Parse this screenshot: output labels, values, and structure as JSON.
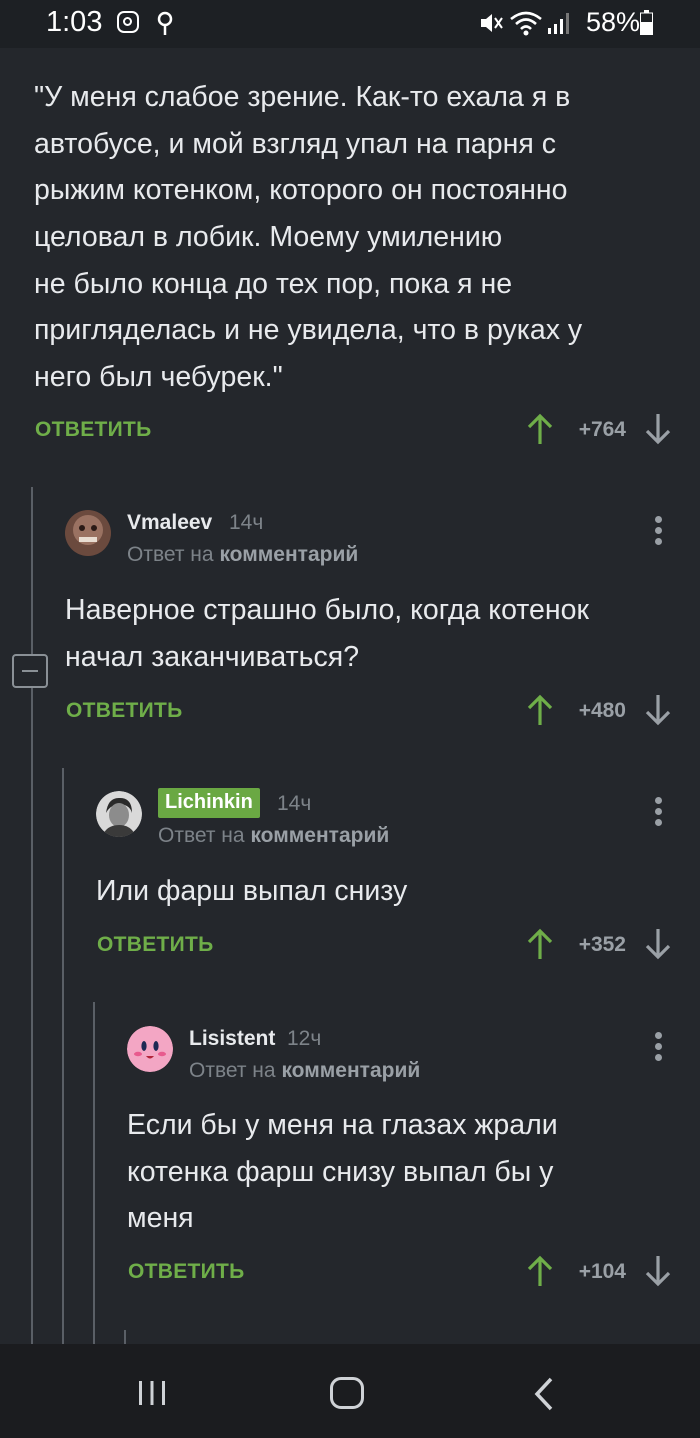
{
  "status_bar": {
    "time": "1:03",
    "battery": "58%",
    "icons": [
      "instagram-icon",
      "location-icon",
      "mute-icon",
      "wifi-icon",
      "signal-icon",
      "battery-icon"
    ]
  },
  "comments": [
    {
      "text_lines": [
        "\"У меня слабое зрение. Как-то ехала я в",
        "автобусе, и мой взгляд упал на парня с",
        "рыжим котенком, которого он постоянно",
        "целовал в лобик. Моему умилению",
        "не было конца до тех пор, пока я не",
        "пригляделась и не увидела, что в руках у",
        "него был чебурек.\""
      ],
      "reply_label": "ОТВЕТИТЬ",
      "score": "+764"
    },
    {
      "username": "Vmaleev",
      "time": "14ч",
      "reply_to_prefix": "Ответ на",
      "reply_to_target": "комментарий",
      "text_lines": [
        "Наверное страшно было, когда котенок",
        "начал заканчиваться?"
      ],
      "reply_label": "ОТВЕТИТЬ",
      "score": "+480"
    },
    {
      "username": "Lichinkin",
      "time": "14ч",
      "reply_to_prefix": "Ответ на",
      "reply_to_target": "комментарий",
      "text_lines": [
        "Или фарш выпал снизу"
      ],
      "reply_label": "ОТВЕТИТЬ",
      "score": "+352"
    },
    {
      "username": "Lisistent",
      "time": "12ч",
      "reply_to_prefix": "Ответ на",
      "reply_to_target": "комментарий",
      "text_lines": [
        "Если бы у меня на глазах жрали",
        "котенка фарш снизу выпал бы у",
        "меня"
      ],
      "reply_label": "ОТВЕТИТЬ",
      "score": "+104"
    }
  ],
  "colors": {
    "background": "#24272c",
    "accent_green": "#6fae49",
    "text": "#e8eaed",
    "muted": "#7d8389"
  },
  "nav_bar": {
    "icons": [
      "recent-apps-icon",
      "home-icon",
      "back-icon"
    ]
  }
}
